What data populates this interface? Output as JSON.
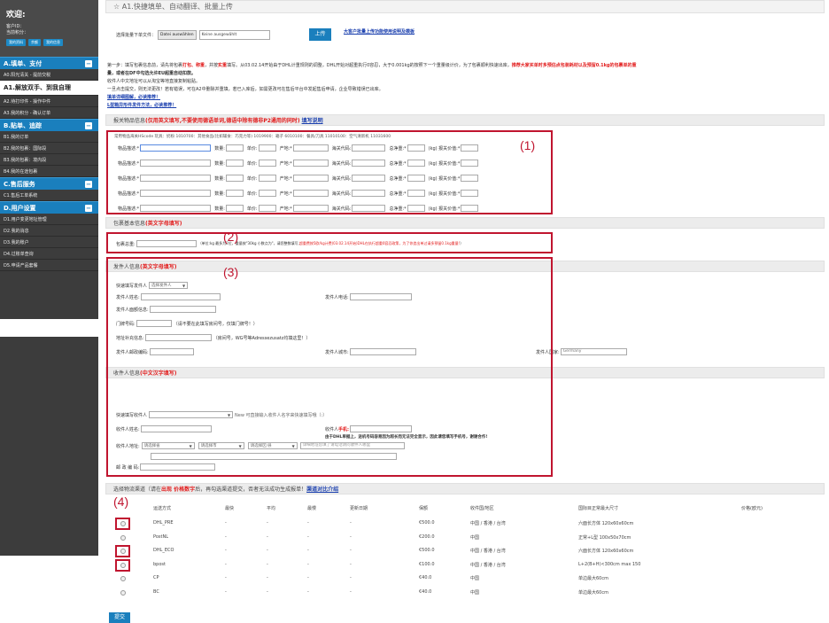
{
  "sidebar": {
    "welcome": "欢迎:",
    "user_lines": [
      "客户ID：",
      "当前积分："
    ],
    "buttons": [
      "我的资料",
      "余额",
      "我的信息"
    ],
    "groups": [
      {
        "title": "A.填单、支付",
        "items": [
          "A0.阳光清关 - 提前交税",
          "A1.解放双手、到我自理",
          "A2.待打印件 - 操作中件",
          "A3.我的积分 - 确认订单"
        ]
      },
      {
        "title": "B.贴单、追踪",
        "items": [
          "B1.我的订单",
          "B2.我的包裹：国际段",
          "B3.我的包裹：境内段",
          "B4.我的在途包裹"
        ]
      },
      {
        "title": "C.售后服务",
        "items": [
          "C1.售后工单系统"
        ]
      },
      {
        "title": "D.用户设置",
        "items": [
          "D1.用户变更地址管理",
          "D2.我的消息",
          "D3.我的账户",
          "D4.过账单查询",
          "D5.申请产品套餐"
        ]
      }
    ]
  },
  "header": {
    "title": "☆ A1.快捷填单、自动翻译、批量上传"
  },
  "upload": {
    "label": "选择批量下单文件：",
    "file_button": "Datei auswählen",
    "file_status": "Keine ausgewählt",
    "upload_button": "上传",
    "help_link": "大客户批量上传功能使用说明及模板"
  },
  "notice": {
    "line1_a": "第一步：填写包裹信息前，请先将包裹",
    "line1_b": "打包、称重",
    "line1_c": "，并按",
    "line1_d": "实重",
    "line1_e": "填写。从03.02.14开始由于DHL计重规则的调整，DHL开始对超重执行0容忍，大于0.001kg的按照下一个重量级计价，为了包裹顺利快速出库，",
    "line1_red": "推荐大家买单时多预估点包装耗材以及预留0.1kg的包裹单的重",
    "line2": "量，或者在DF中勾选允许EU超重自动扣款。",
    "line3": "收件人中文地址可以从淘宝等地直接复制粘贴。",
    "line4": "一旦点击提交，则无法更改！若有错误，可在A2中删除并重填，若已入库后，如需更改可在售后平台中发起售后申请，企业导致错误已出库。",
    "link1": "填单详细图解，必读推荐！",
    "link2": "L型箱异形件发件方法，必读推荐！"
  },
  "goods": {
    "section_title": "报关物品信息 ",
    "section_red": "(仅用英文填写,不要使用德语单词,德语中除有德非P2通用的同时)",
    "section_link": "填写说明",
    "hs_hint": "常用物品海关HScode 玩具：奶粉 1010700：其他食品(比如辅食：巧克力等) 1019900：箱子 6010100：餐具/刀具 11010100：空气清新机 11031600",
    "labels": {
      "desc": "物品描述:*",
      "qty": "数量:",
      "price": "单价:",
      "origin": "产地:*",
      "hs": "海关代码:",
      "weight": "总净重:*",
      "kg": "(kg) 报关价值:*"
    },
    "rows": 5,
    "annot": "(1)"
  },
  "parcel": {
    "section_title": "包裹基本信息 ",
    "section_red": "(英文字母填写)",
    "weight_label": "包裹总重:",
    "hint_a": "（单位:kg 最多为2位，重量按\"30kg 小数点为\"，请您整数填写,",
    "hint_red": "超重费按5欧/kg计费(03.02.14开始)DHL在执行超重0容忍政策，为了你造出单过请多预留0.1kg重量!",
    "hint_b": "）",
    "annot": "(2)"
  },
  "sender": {
    "section_title": "发件人信息 ",
    "section_red": "(英文字母填写)",
    "quick_label": "快速填写发件人",
    "quick_select": "选择发件人",
    "name": "发件人姓名:",
    "phone": "发件人电话:",
    "company": "发件人面额信息:",
    "house": "门牌号码:",
    "house_hint": "（请不要在此填写房间号，仅填门牌号！）",
    "addr_extra": "地址补充信息:",
    "addr_hint": "（房间号，WG号等Adressezusatz均填这里！）",
    "zip": "发件人邮政编码:",
    "city": "发件人城市:",
    "country": "发件人国家:",
    "country_value": "Germany",
    "annot": "(3)"
  },
  "receiver": {
    "section_title": "收件人信息 ",
    "section_red": "(中文汉字填写)",
    "quick_label": "快速填写收件人",
    "quick_hint": "New 可直接输入收件人名字来快速填写哦（:）",
    "name": "收件人姓名:",
    "mobile_label": "收件人",
    "mobile_red": "手机:",
    "mobile_hint": "由于DHL单据上，送机号码容易因为超长而无法完全显示，因此请您填写手机号，谢谢合作!",
    "addr": "收件人地址:",
    "sel_province": "请选择省",
    "sel_city": "请选择市",
    "sel_district": "请选择区/县",
    "addr_placeholder": "详细地址您填了请电话请问收件人哪里",
    "zip": "邮 政 编 码:"
  },
  "channel": {
    "section_title": "选择物流渠道（请在",
    "section_red": "出现 价格数字",
    "section_b": "后，再勾选渠道提交，否者无法成功生成报单！",
    "section_link": "渠道对比介绍",
    "columns": [
      "运送方式",
      "最快",
      "平均",
      "最慢",
      "更新日期",
      "保额",
      "收件国/地区",
      "国际目正常最大尺寸",
      "价格(欧元)"
    ],
    "rows": [
      {
        "name": "DHL_PRE",
        "fast": "-",
        "avg": "-",
        "slow": "-",
        "date": "-",
        "ins": "€500.0",
        "region": "中国 / 香港 / 台湾",
        "size": "六面长方体 120x60x60cm",
        "price": ""
      },
      {
        "name": "PostNL",
        "fast": "-",
        "avg": "-",
        "slow": "-",
        "date": "-",
        "ins": "€200.0",
        "region": "中国",
        "size": "正常+L型 100x50x70cm",
        "price": ""
      },
      {
        "name": "DHL_ECO",
        "fast": "-",
        "avg": "-",
        "slow": "-",
        "date": "-",
        "ins": "€500.0",
        "region": "中国 / 香港 / 台湾",
        "size": "六面长方体 120x60x60cm",
        "price": ""
      },
      {
        "name": "bpost",
        "fast": "-",
        "avg": "-",
        "slow": "-",
        "date": "-",
        "ins": "€100.0",
        "region": "中国 / 香港 / 台湾",
        "size": "L+2(B+H)<300cm max 150",
        "price": ""
      },
      {
        "name": "CP",
        "fast": "-",
        "avg": "-",
        "slow": "-",
        "date": "-",
        "ins": "€40.0",
        "region": "中国",
        "size": "单边最大60cm",
        "price": ""
      },
      {
        "name": "BC",
        "fast": "-",
        "avg": "-",
        "slow": "-",
        "date": "-",
        "ins": "€40.0",
        "region": "中国",
        "size": "单边最大60cm",
        "price": ""
      }
    ],
    "annot": "(4)"
  },
  "submit_label": "提交",
  "colors": {
    "accent": "#1a7fbd",
    "annotation": "#c0152f",
    "warning": "#e21d1d"
  }
}
